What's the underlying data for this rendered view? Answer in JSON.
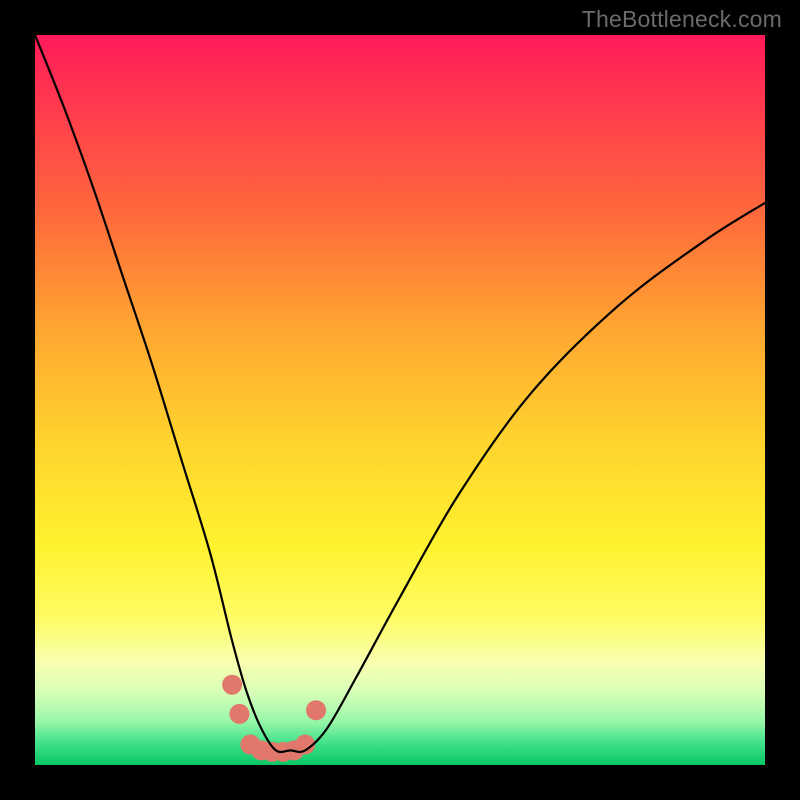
{
  "watermark": "TheBottleneck.com",
  "chart_data": {
    "type": "line",
    "title": "",
    "xlabel": "",
    "ylabel": "",
    "xlim": [
      0,
      100
    ],
    "ylim": [
      0,
      100
    ],
    "series": [
      {
        "name": "bottleneck-curve",
        "x": [
          0,
          4,
          8,
          12,
          16,
          20,
          24,
          27,
          29,
          31,
          33,
          35,
          37,
          40,
          44,
          50,
          58,
          68,
          80,
          92,
          100
        ],
        "values": [
          100,
          90,
          79,
          67,
          55,
          42,
          29,
          17,
          10,
          5,
          2,
          2,
          2,
          5,
          12,
          23,
          37,
          51,
          63,
          72,
          77
        ]
      }
    ],
    "markers": {
      "name": "highlight-dots",
      "x": [
        27.0,
        28.0,
        29.5,
        31.0,
        32.5,
        34.0,
        35.5,
        37.0,
        38.5
      ],
      "values": [
        11.0,
        7.0,
        2.8,
        2.0,
        1.8,
        1.8,
        2.0,
        2.8,
        7.5
      ],
      "color": "#e2786b",
      "radius_px": 10
    },
    "gradient_stops": [
      {
        "pos": 0.0,
        "color": "#ff1a5a"
      },
      {
        "pos": 0.25,
        "color": "#ff6b3b"
      },
      {
        "pos": 0.55,
        "color": "#ffd22e"
      },
      {
        "pos": 0.8,
        "color": "#fffc65"
      },
      {
        "pos": 1.0,
        "color": "#07c765"
      }
    ]
  }
}
